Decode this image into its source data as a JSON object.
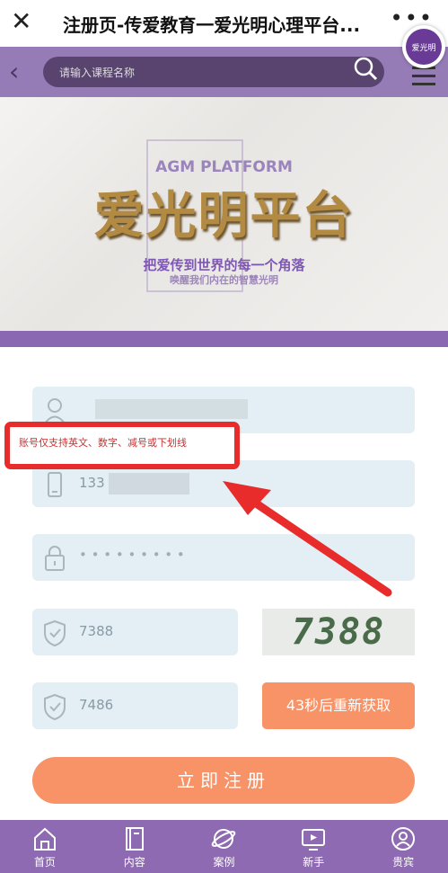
{
  "window": {
    "title": "注册页-传爱教育一爱光明心理平台...",
    "close_glyph": "✕",
    "more_glyph": "•••"
  },
  "logo": {
    "text": "爱光明"
  },
  "nav": {
    "back_glyph": "‹",
    "search_placeholder": "请输入课程名称"
  },
  "banner": {
    "platform": "AGM PLATFORM",
    "title": "爱光明平台",
    "subtitle1": "把爱传到世界的每一个角落",
    "subtitle2": "唤醒我们内在的智慧光明"
  },
  "form": {
    "username_value": "",
    "phone_value": "133",
    "password_value": "• • • • • • • • •",
    "captcha_input": "7388",
    "captcha_image_text": "7388",
    "sms_code": "7486",
    "resend_label": "43秒后重新获取",
    "register_label": "立即注册",
    "tooltip": "账号仅支持英文、数字、减号或下划线"
  },
  "tabs": [
    {
      "label": "首页",
      "icon": "home-icon"
    },
    {
      "label": "内容",
      "icon": "book-icon"
    },
    {
      "label": "案例",
      "icon": "planet-icon"
    },
    {
      "label": "新手",
      "icon": "monitor-icon"
    },
    {
      "label": "贵宾",
      "icon": "user-icon"
    }
  ],
  "colors": {
    "accent": "#f89267",
    "purple": "#8d6ab1",
    "alert": "#e82c2c"
  }
}
